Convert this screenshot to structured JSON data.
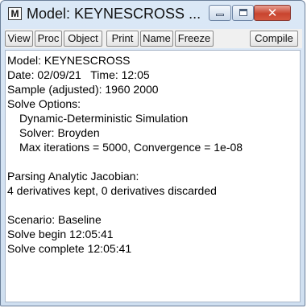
{
  "window": {
    "title": "Model: KEYNESCROSS ...",
    "app_icon_letter": "M",
    "controls": {
      "minimize": "minimize-icon",
      "maximize": "maximize-icon",
      "close": "close-icon"
    }
  },
  "toolbar": {
    "view": "View",
    "proc": "Proc",
    "object": "Object",
    "print": "Print",
    "name": "Name",
    "freeze": "Freeze",
    "compile": "Compile"
  },
  "output": {
    "model": "Model: KEYNESCROSS",
    "date": "Date: 02/09/21   Time: 12:05",
    "sample": "Sample (adjusted): 1960 2000",
    "solve_options": "Solve Options:",
    "simulation": "Dynamic-Deterministic Simulation",
    "solver": "Solver: Broyden",
    "max_iter": "Max iterations = 5000, Convergence = 1e-08",
    "parsing": "Parsing Analytic Jacobian:",
    "derivatives": "4 derivatives kept, 0 derivatives discarded",
    "scenario": "Scenario: Baseline",
    "solve_begin": "Solve begin 12:05:41",
    "solve_complete": "Solve complete 12:05:41"
  }
}
